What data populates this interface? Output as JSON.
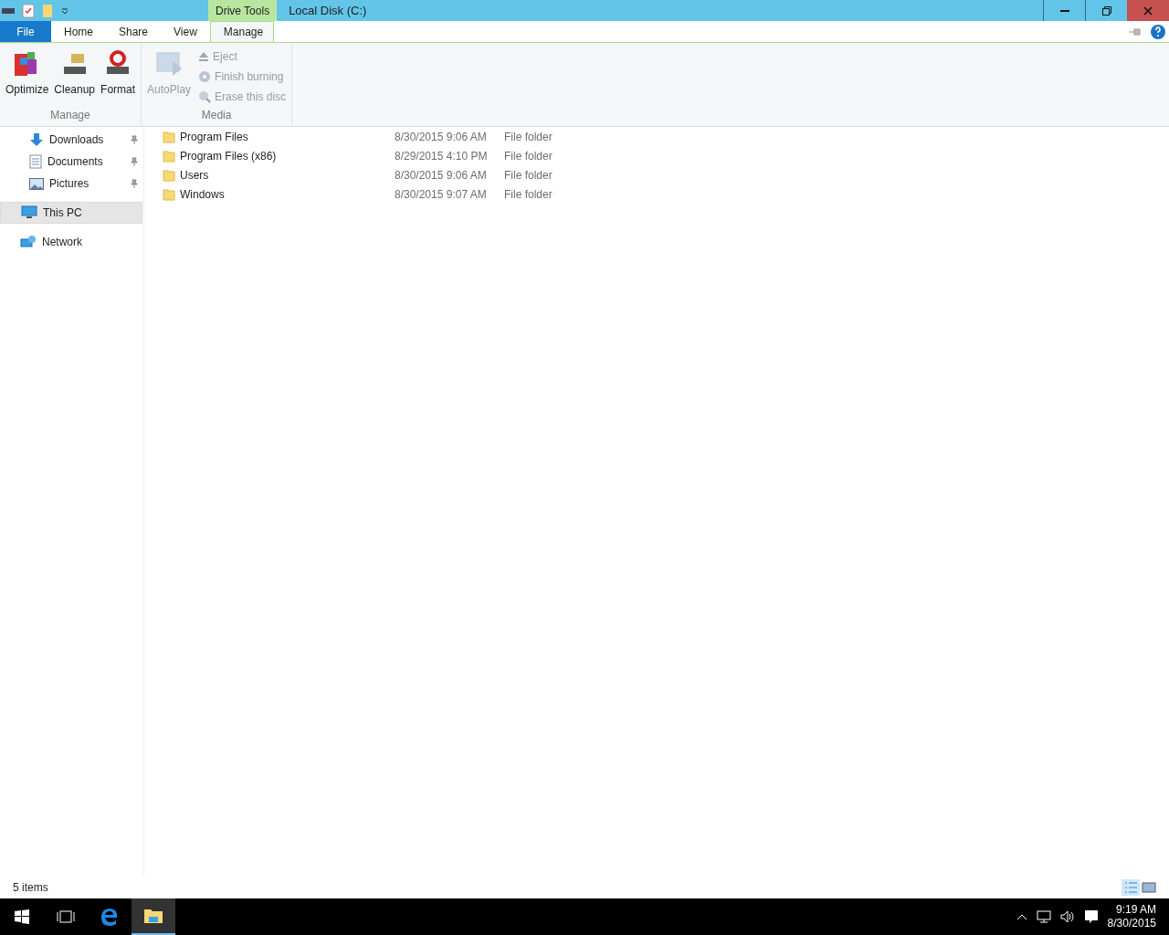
{
  "window": {
    "title": "Local Disk (C:)",
    "context_tab": "Drive Tools"
  },
  "ribbon_tabs": [
    {
      "label": "File",
      "kind": "file",
      "selected": false
    },
    {
      "label": "Home",
      "kind": "tab",
      "selected": false
    },
    {
      "label": "Share",
      "kind": "tab",
      "selected": false
    },
    {
      "label": "View",
      "kind": "tab",
      "selected": false
    },
    {
      "label": "Manage",
      "kind": "tab",
      "selected": true
    }
  ],
  "ribbon_groups": [
    {
      "label": "Manage",
      "large": [
        {
          "label": "Optimize",
          "kind": "optimize",
          "disabled": false
        },
        {
          "label": "Cleanup",
          "kind": "cleanup",
          "disabled": false
        },
        {
          "label": "Format",
          "kind": "format",
          "disabled": false
        }
      ]
    },
    {
      "label": "Media",
      "large": [
        {
          "label": "AutoPlay",
          "kind": "autoplay",
          "disabled": true
        }
      ],
      "small": [
        {
          "label": "Eject",
          "kind": "eject",
          "disabled": true
        },
        {
          "label": "Finish burning",
          "kind": "disc",
          "disabled": true
        },
        {
          "label": "Erase this disc",
          "kind": "erase",
          "disabled": true
        }
      ]
    }
  ],
  "nav": [
    {
      "label": "Downloads",
      "kind": "downloads",
      "pinned": true,
      "selected": false
    },
    {
      "label": "Documents",
      "kind": "documents",
      "pinned": true,
      "selected": false
    },
    {
      "label": "Pictures",
      "kind": "pictures",
      "pinned": true,
      "selected": false
    },
    {
      "label": "This PC",
      "kind": "pc",
      "pinned": false,
      "selected": true
    },
    {
      "label": "Network",
      "kind": "network",
      "pinned": false,
      "selected": false
    }
  ],
  "files": [
    {
      "name": "Program Files",
      "date": "8/30/2015 9:06 AM",
      "type": "File folder"
    },
    {
      "name": "Program Files (x86)",
      "date": "8/29/2015 4:10 PM",
      "type": "File folder"
    },
    {
      "name": "Users",
      "date": "8/30/2015 9:06 AM",
      "type": "File folder"
    },
    {
      "name": "Windows",
      "date": "8/30/2015 9:07 AM",
      "type": "File folder"
    }
  ],
  "status_bar": {
    "count": "5 items"
  },
  "taskbar": {
    "time": "9:19 AM",
    "date": "8/30/2015"
  }
}
